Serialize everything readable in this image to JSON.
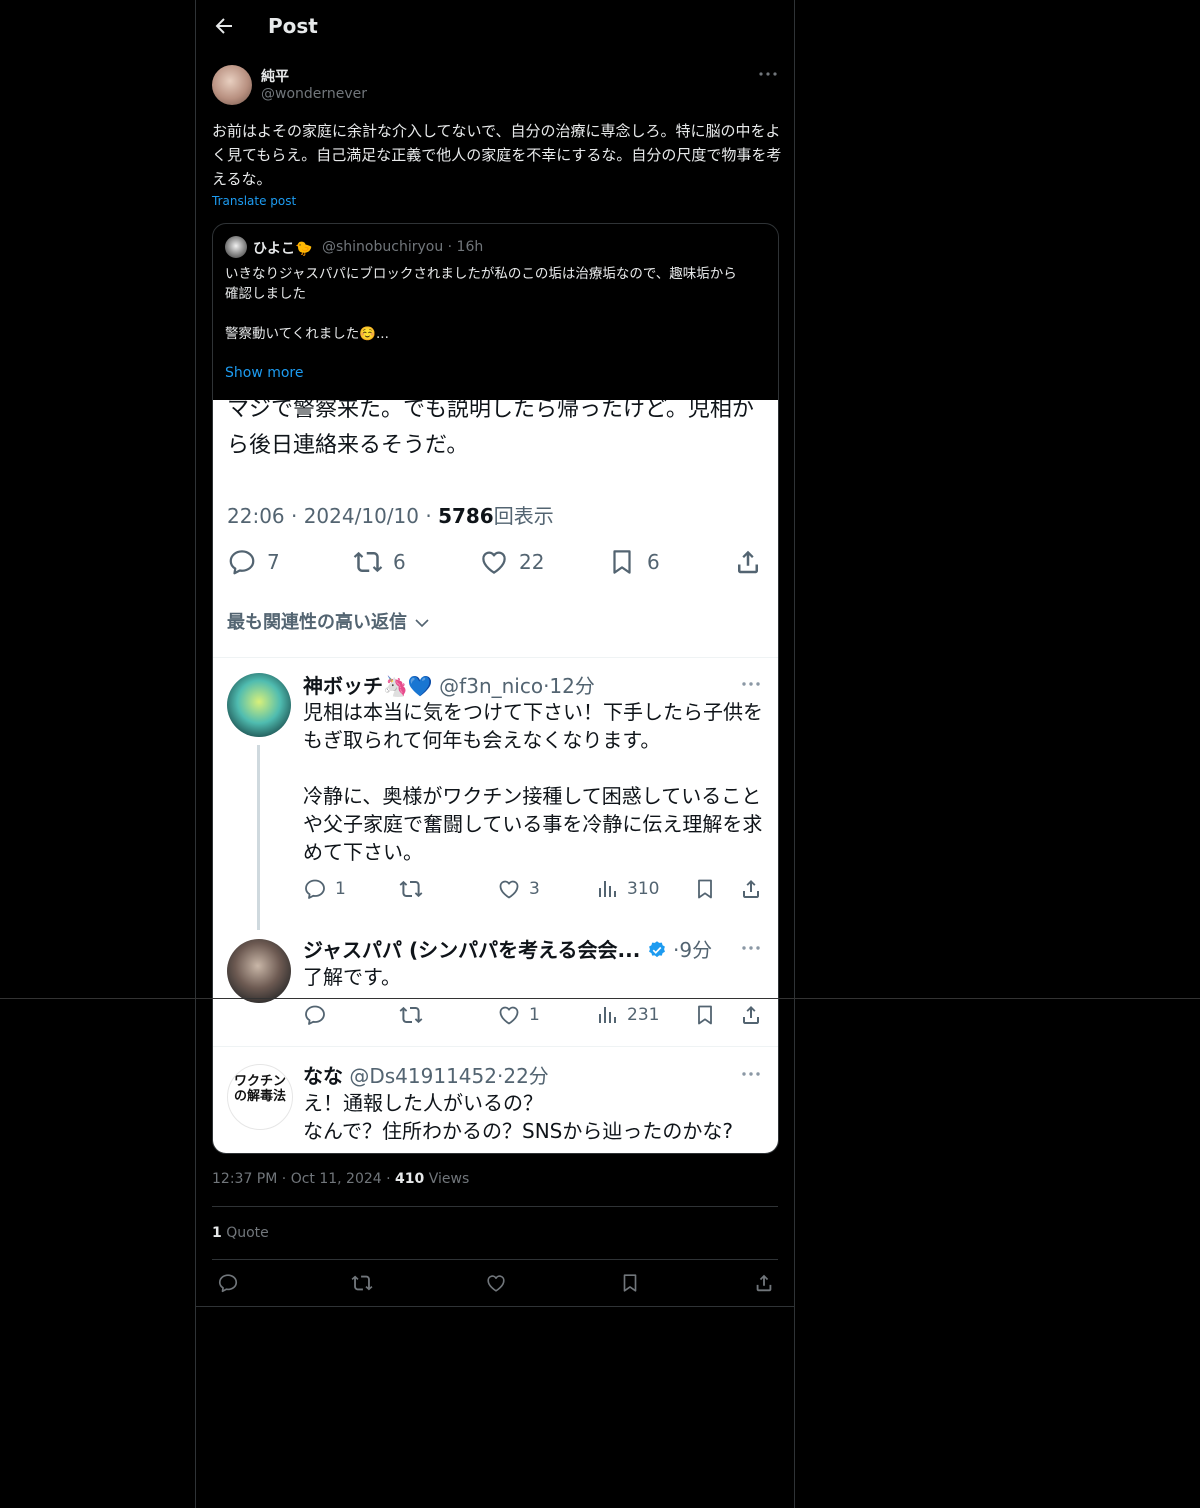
{
  "header": {
    "title": "Post"
  },
  "post": {
    "author_name": "純平",
    "author_handle": "@wondernever",
    "text": "お前はよその家庭に余計な介入してないで、自分の治療に専念しろ。特に脳の中をよく見てもらえ。自己満足な正義で他人の家庭を不幸にするな。自分の尺度で物事を考えるな。",
    "translate_label": "Translate post",
    "timestamp": "12:37 PM",
    "date": "Oct 11, 2024",
    "views_count": "410",
    "views_label": "Views",
    "quote_count": "1",
    "quote_label": "Quote"
  },
  "quoted": {
    "author_name": "ひよこ🐤",
    "author_handle": "@shinobuchiryou",
    "age": "· 16h",
    "text": "いきなりジャスパパにブロックされましたが私のこの垢は治療垢なので、趣味垢から\n確認しました\n\n警察動いてくれました☺️...",
    "show_more": "Show more"
  },
  "screenshot": {
    "text": "マジで警察来た。でも説明したら帰ったけど。児相から後日連絡来るそうだ。",
    "meta_time": "22:06 · 2024/10/10 · ",
    "meta_views": "5786",
    "meta_views_label": "回表示",
    "counts": {
      "reply": "7",
      "repost": "6",
      "like": "22",
      "bookmark": "6"
    },
    "sort_label": "最も関連性の高い返信",
    "replies": [
      {
        "name": "神ボッチ🦄💙",
        "handle": "@f3n_nico",
        "age": "·12分",
        "text": "児相は本当に気をつけて下さい！下手したら子供をもぎ取られて何年も会えなくなります。\n\n冷静に、奥様がワクチン接種して困惑していることや父子家庭で奮闘している事を冷静に伝え理解を求めて下さい。",
        "reply": "1",
        "like": "3",
        "views": "310"
      },
      {
        "name": "ジャスパパ (シンパパを考える会会...",
        "age": "·9分",
        "text": "了解です。",
        "reply": "",
        "like": "1",
        "views": "231"
      },
      {
        "name": "なな",
        "handle": "@Ds41911452",
        "age": "·22分",
        "text": "え！通報した人がいるの？\nなんで？住所わかるの？SNSから辿ったのかな?",
        "avatar_text": "ワクチンの解毒法"
      }
    ]
  },
  "colors": {
    "accent": "#1d9bf0",
    "muted": "#71767b",
    "background": "#000000",
    "verified": "#1d9bf0"
  }
}
